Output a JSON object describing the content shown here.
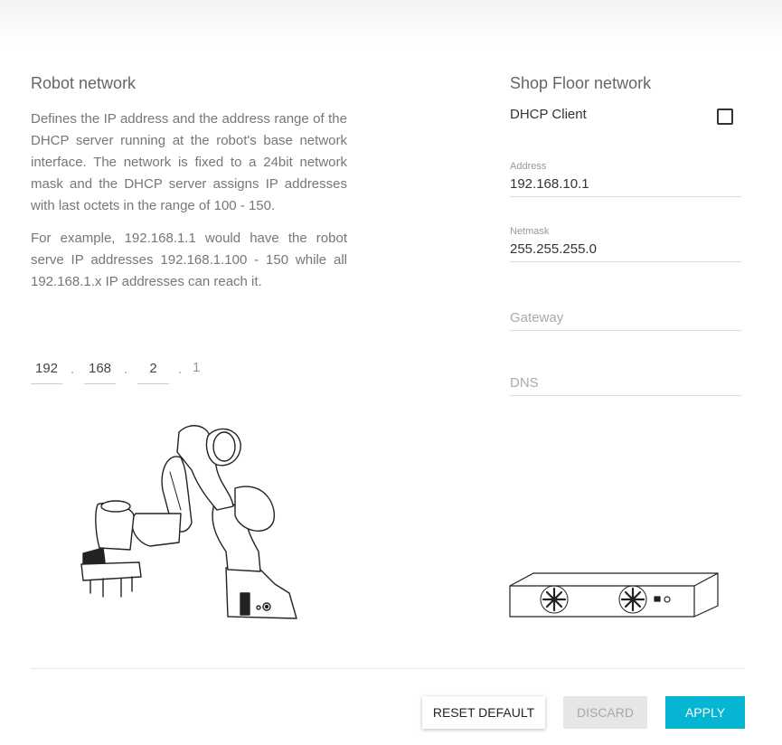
{
  "robot_network": {
    "title": "Robot network",
    "description_1": "Defines the IP address and the address range of the DHCP server running at the robot's base network interface. The network is fixed to a 24bit network mask and the DHCP server assigns IP addresses with last octets in the range of 100 - 150.",
    "description_2": "For example, 192.168.1.1 would have the robot serve IP addresses 192.168.1.100 - 150 while all 192.168.1.x IP addresses can reach it.",
    "ip": {
      "octet1": "192",
      "octet2": "168",
      "octet3": "2",
      "octet4": "1",
      "separator": "."
    }
  },
  "shop_floor": {
    "title": "Shop Floor network",
    "dhcp_label": "DHCP Client",
    "dhcp_checked": false,
    "address": {
      "label": "Address",
      "value": "192.168.10.1"
    },
    "netmask": {
      "label": "Netmask",
      "value": "255.255.255.0"
    },
    "gateway": {
      "placeholder": "Gateway",
      "value": ""
    },
    "dns": {
      "placeholder": "DNS",
      "value": ""
    }
  },
  "actions": {
    "reset_label": "RESET DEFAULT",
    "discard_label": "DISCARD",
    "apply_label": "APPLY"
  },
  "colors": {
    "accent": "#06b4d3",
    "disabled_bg": "#e6e6e6"
  },
  "icons": {
    "robot": "robot-arm-illustration",
    "switch": "network-switch-illustration"
  }
}
